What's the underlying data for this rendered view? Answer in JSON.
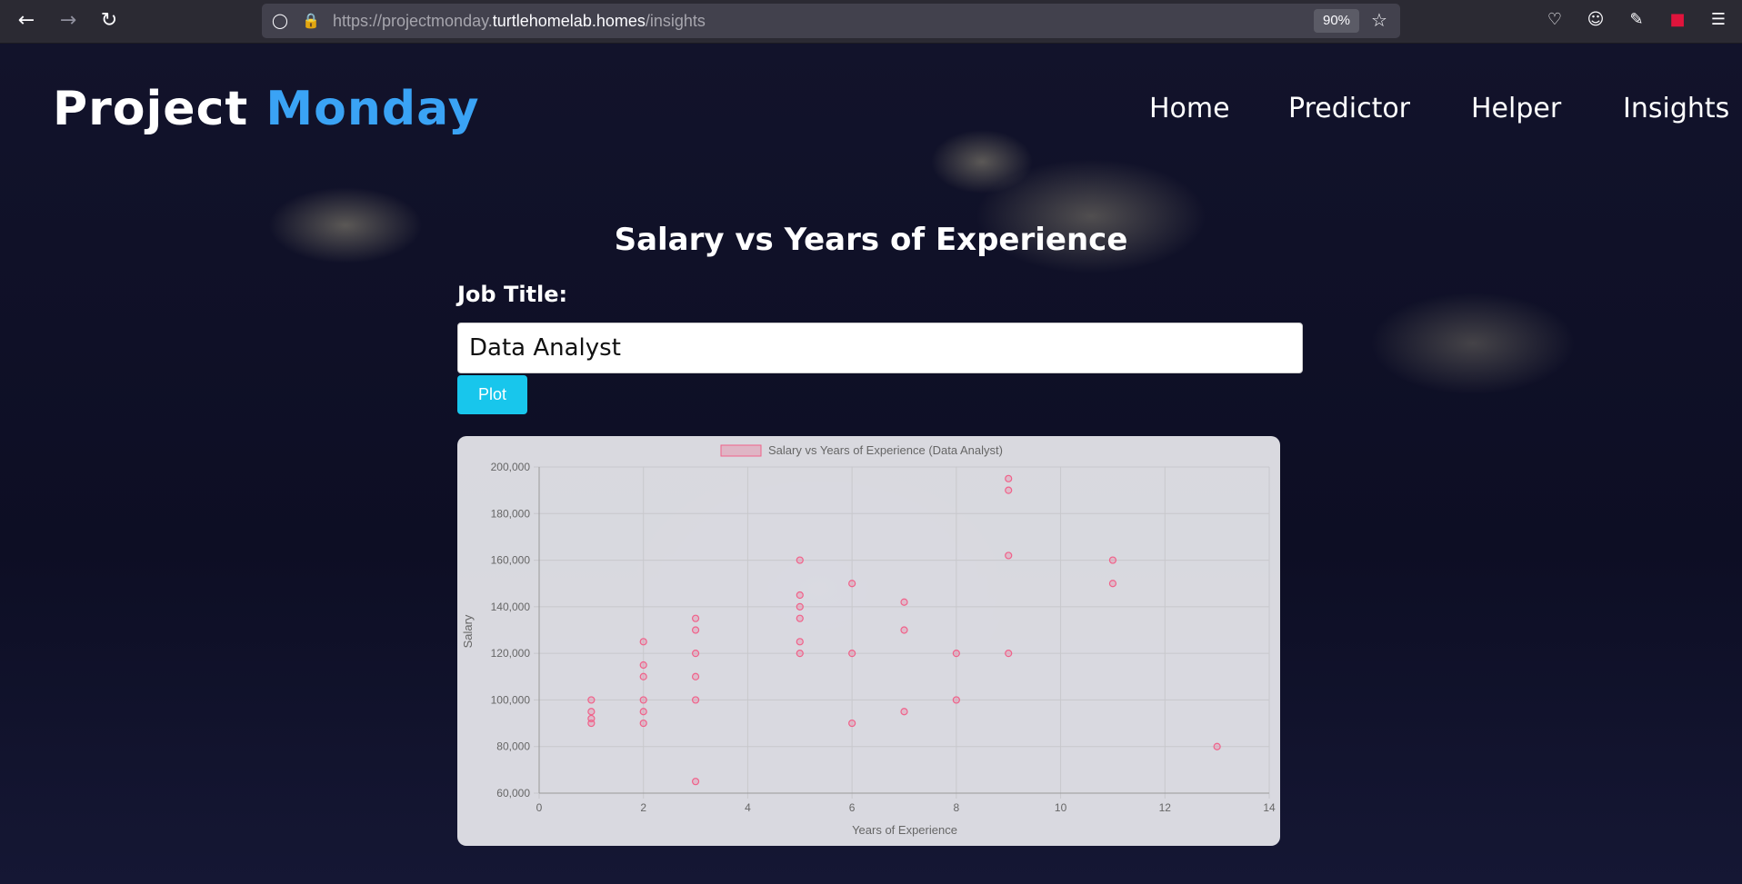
{
  "browser": {
    "url_prefix": "https://projectmonday.",
    "url_host": "turtlehomelab.homes",
    "url_path": "/insights",
    "zoom": "90%"
  },
  "brand": {
    "part1": "Project",
    "part2": "Monday"
  },
  "nav": {
    "items": [
      "Home",
      "Predictor",
      "Helper",
      "Insights"
    ]
  },
  "page": {
    "title": "Salary vs Years of Experience",
    "job_label": "Job Title:",
    "job_value": "Data Analyst",
    "plot_label": "Plot"
  },
  "colors": {
    "accent": "#3aa3f5",
    "button": "#18c6ec",
    "point": "#f0628a"
  },
  "chart_data": {
    "type": "scatter",
    "legend": "Salary vs Years of Experience (Data Analyst)",
    "xlabel": "Years of Experience",
    "ylabel": "Salary",
    "xlim": [
      0,
      14
    ],
    "ylim": [
      60000,
      200000
    ],
    "xticks": [
      "0",
      "2",
      "4",
      "6",
      "8",
      "10",
      "12",
      "14"
    ],
    "yticks": [
      "60,000",
      "80,000",
      "100,000",
      "120,000",
      "140,000",
      "160,000",
      "180,000",
      "200,000"
    ],
    "points": [
      [
        1,
        100000
      ],
      [
        1,
        95000
      ],
      [
        1,
        92000
      ],
      [
        1,
        90000
      ],
      [
        2,
        125000
      ],
      [
        2,
        115000
      ],
      [
        2,
        110000
      ],
      [
        2,
        100000
      ],
      [
        2,
        95000
      ],
      [
        2,
        90000
      ],
      [
        3,
        135000
      ],
      [
        3,
        130000
      ],
      [
        3,
        120000
      ],
      [
        3,
        110000
      ],
      [
        3,
        100000
      ],
      [
        3,
        65000
      ],
      [
        5,
        160000
      ],
      [
        5,
        145000
      ],
      [
        5,
        140000
      ],
      [
        5,
        135000
      ],
      [
        5,
        125000
      ],
      [
        5,
        120000
      ],
      [
        6,
        150000
      ],
      [
        6,
        120000
      ],
      [
        6,
        90000
      ],
      [
        7,
        142000
      ],
      [
        7,
        130000
      ],
      [
        7,
        95000
      ],
      [
        8,
        120000
      ],
      [
        8,
        100000
      ],
      [
        9,
        195000
      ],
      [
        9,
        190000
      ],
      [
        9,
        162000
      ],
      [
        9,
        120000
      ],
      [
        11,
        160000
      ],
      [
        11,
        150000
      ],
      [
        13,
        80000
      ]
    ]
  }
}
